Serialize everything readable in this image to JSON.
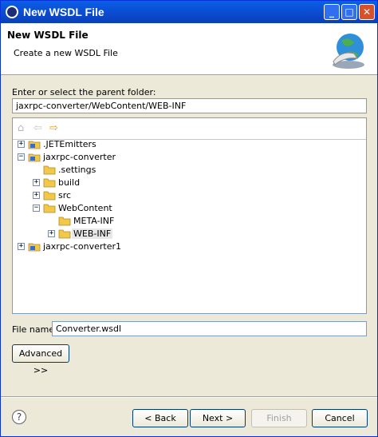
{
  "window": {
    "title": "New WSDL File",
    "min_glyph": "_",
    "max_glyph": "□",
    "close_glyph": "✕"
  },
  "banner": {
    "title": "New WSDL File",
    "description": "Create a new WSDL File"
  },
  "folder": {
    "label": "Enter or select the parent folder:",
    "value": "jaxrpc-converter/WebContent/WEB-INF"
  },
  "tree": {
    "items": [
      {
        "label": ".JETEmitters",
        "icon": "project-icon",
        "expander": "+"
      },
      {
        "label": "jaxrpc-converter",
        "icon": "project-icon",
        "expander": "−"
      },
      {
        "label": ".settings",
        "icon": "folder-icon",
        "expander": ""
      },
      {
        "label": "build",
        "icon": "folder-icon",
        "expander": "+"
      },
      {
        "label": "src",
        "icon": "folder-icon",
        "expander": "+"
      },
      {
        "label": "WebContent",
        "icon": "folder-icon",
        "expander": "−"
      },
      {
        "label": "META-INF",
        "icon": "folder-icon",
        "expander": ""
      },
      {
        "label": "WEB-INF",
        "icon": "folder-icon",
        "expander": "+",
        "selected": true
      },
      {
        "label": "jaxrpc-converter1",
        "icon": "project-icon",
        "expander": "+"
      }
    ]
  },
  "file_name": {
    "label": "File name:",
    "value": "Converter.wsdl"
  },
  "buttons": {
    "advanced": "Advanced >>",
    "back": "< Back",
    "next": "Next >",
    "finish": "Finish",
    "cancel": "Cancel",
    "help": "?"
  },
  "colors": {
    "titlebar": "#0a5fe6",
    "dialog_bg": "#ece9d8",
    "folder": "#f3c84a"
  }
}
